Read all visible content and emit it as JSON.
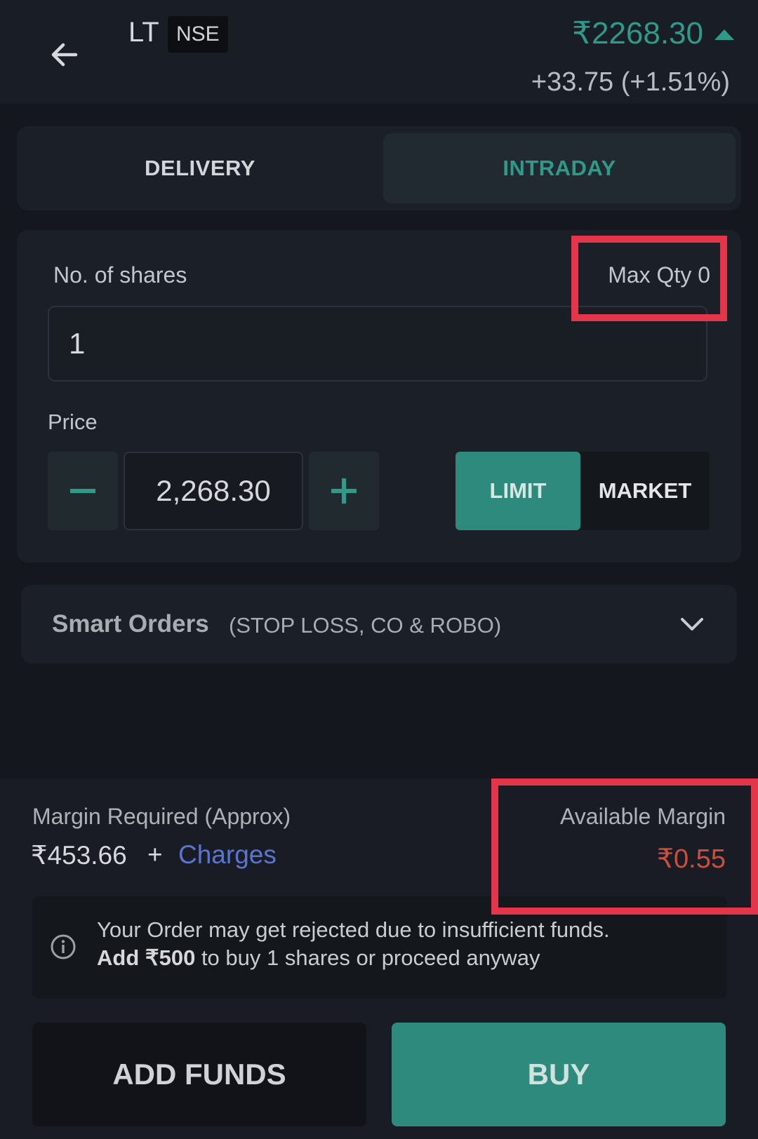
{
  "header": {
    "symbol": "LT",
    "exchange": "NSE",
    "price": "₹2268.30",
    "change": "+33.75 (+1.51%)"
  },
  "tabs": {
    "delivery": "DELIVERY",
    "intraday": "INTRADAY",
    "active": "INTRADAY"
  },
  "order": {
    "shares_label": "No. of shares",
    "max_qty": "Max Qty 0",
    "quantity": "1",
    "price_label": "Price",
    "price": "2,268.30",
    "limit_label": "LIMIT",
    "market_label": "MARKET",
    "selected_type": "LIMIT"
  },
  "smart_orders": {
    "title": "Smart Orders",
    "subtitle": "(STOP LOSS, CO & ROBO)"
  },
  "margin": {
    "required_label": "Margin Required (Approx)",
    "required_value": "₹453.66",
    "plus": "+",
    "charges_label": "Charges",
    "available_label": "Available Margin",
    "available_value": "₹0.55"
  },
  "notice": {
    "line1": "Your Order may get rejected due to insufficient funds.",
    "line2_bold": "Add ₹500",
    "line2_rest": " to buy 1 shares or proceed anyway"
  },
  "actions": {
    "add_funds": "ADD FUNDS",
    "buy": "BUY"
  },
  "colors": {
    "accent": "#2e8a7c",
    "up": "#2f9a89",
    "negative": "#c9503c",
    "link": "#5a75d0",
    "highlight": "#e5354a"
  }
}
